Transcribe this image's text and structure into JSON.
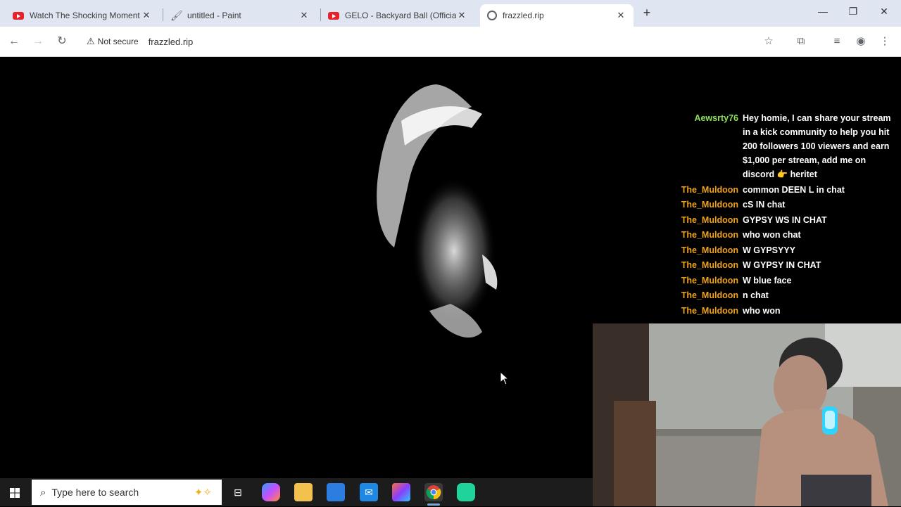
{
  "tabs": [
    {
      "title": "Watch The Shocking Moment H",
      "icon": "youtube-icon"
    },
    {
      "title": "untitled - Paint",
      "icon": "paint-icon"
    },
    {
      "title": "GELO - Backyard Ball (Official M",
      "icon": "youtube-icon"
    },
    {
      "title": "frazzled.rip",
      "icon": "globe-icon",
      "active": true
    }
  ],
  "address_bar": {
    "security_label": "Not secure",
    "url": "frazzled.rip"
  },
  "chat": [
    {
      "user": "Aewsrty76",
      "color": "#8de05a",
      "text": "Hey homie, I can share your stream in a kick community to help you hit 200 followers 100 viewers and earn $1,000 per stream, add me on discord 👉 heritet"
    },
    {
      "user": "The_Muldoon",
      "color": "#f0a21a",
      "text": "common DEEN L in chat"
    },
    {
      "user": "The_Muldoon",
      "color": "#f0a21a",
      "text": "cS IN chat"
    },
    {
      "user": "The_Muldoon",
      "color": "#f0a21a",
      "text": "GYPSY WS IN CHAT"
    },
    {
      "user": "The_Muldoon",
      "color": "#f0a21a",
      "text": "who won chat"
    },
    {
      "user": "The_Muldoon",
      "color": "#f0a21a",
      "text": "W GYPSYYY"
    },
    {
      "user": "The_Muldoon",
      "color": "#f0a21a",
      "text": "W GYPSY IN CHAT"
    },
    {
      "user": "The_Muldoon",
      "color": "#f0a21a",
      "text": "W blue face"
    },
    {
      "user": "The_Muldoon",
      "color": "#f0a21a",
      "text": "n chat"
    },
    {
      "user": "The_Muldoon",
      "color": "#f0a21a",
      "text": "who won"
    }
  ],
  "taskbar": {
    "search_placeholder": "Type here to search"
  },
  "colors": {
    "tabbar_bg": "#dfe6f1",
    "page_bg": "#000000",
    "taskbar_bg": "#1c1c1c"
  }
}
